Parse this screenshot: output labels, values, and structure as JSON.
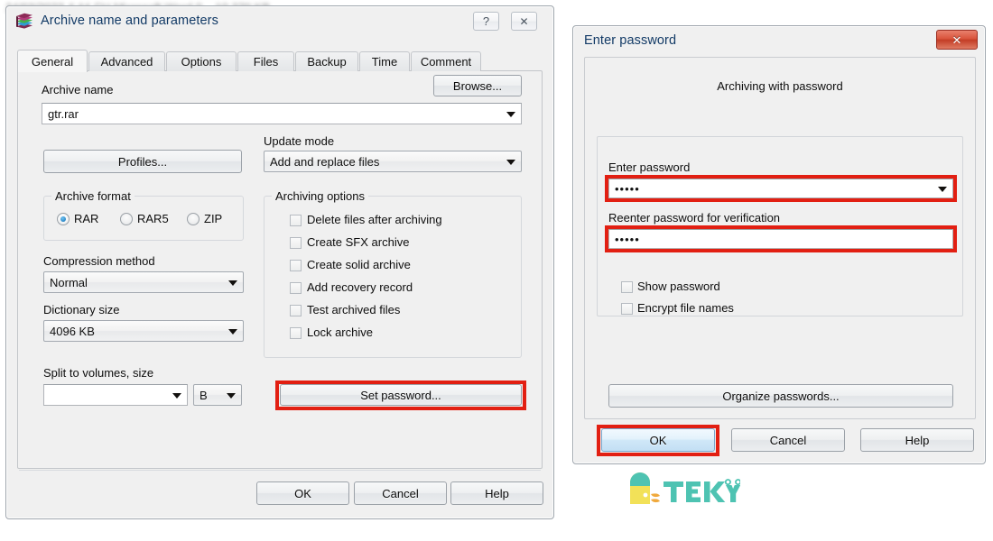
{
  "background_strip": {
    "blurred_text": "24/03/2023 4:44 CH      Microsoft Word 0...                  10.270 KB"
  },
  "archive_dialog": {
    "title": "Archive name and parameters",
    "icon": "winrar-books-icon",
    "titlebar_buttons": {
      "help": "?",
      "close": "✕"
    },
    "tabs": [
      {
        "label": "General",
        "active": true
      },
      {
        "label": "Advanced",
        "active": false
      },
      {
        "label": "Options",
        "active": false
      },
      {
        "label": "Files",
        "active": false
      },
      {
        "label": "Backup",
        "active": false
      },
      {
        "label": "Time",
        "active": false
      },
      {
        "label": "Comment",
        "active": false
      }
    ],
    "archive_name": {
      "label": "Archive name",
      "value": "gtr.rar"
    },
    "browse_button": "Browse...",
    "profiles_button": "Profiles...",
    "update_mode": {
      "label": "Update mode",
      "value": "Add and replace files"
    },
    "archive_format": {
      "label": "Archive format",
      "options": [
        {
          "label": "RAR",
          "selected": true
        },
        {
          "label": "RAR5",
          "selected": false
        },
        {
          "label": "ZIP",
          "selected": false
        }
      ]
    },
    "compression_method": {
      "label": "Compression method",
      "value": "Normal"
    },
    "dictionary_size": {
      "label": "Dictionary size",
      "value": "4096 KB"
    },
    "split_to_volumes": {
      "label": "Split to volumes, size",
      "value": "",
      "unit": "B"
    },
    "archiving_options": {
      "label": "Archiving options",
      "items": [
        {
          "label": "Delete files after archiving",
          "checked": false
        },
        {
          "label": "Create SFX archive",
          "checked": false
        },
        {
          "label": "Create solid archive",
          "checked": false
        },
        {
          "label": "Add recovery record",
          "checked": false
        },
        {
          "label": "Test archived files",
          "checked": false
        },
        {
          "label": "Lock archive",
          "checked": false
        }
      ]
    },
    "set_password_button": "Set password...",
    "footer_buttons": {
      "ok": "OK",
      "cancel": "Cancel",
      "help": "Help"
    }
  },
  "password_dialog": {
    "title": "Enter password",
    "close_button": "✕",
    "group_heading": "Archiving with password",
    "enter_password": {
      "label": "Enter password",
      "value": "•••••"
    },
    "reenter_password": {
      "label": "Reenter password for verification",
      "value": "•••••"
    },
    "checkboxes": [
      {
        "label": "Show password",
        "checked": false
      },
      {
        "label": "Encrypt file names",
        "checked": false
      }
    ],
    "organize_button": "Organize passwords...",
    "footer_buttons": {
      "ok": "OK",
      "cancel": "Cancel",
      "help": "Help"
    }
  },
  "watermark": {
    "text": "TEKY",
    "colors": {
      "letters": "#4ec3b2",
      "door_body": "#f5e04a",
      "door_top": "#4ec3b2",
      "leaf": "#f0a93c"
    }
  },
  "highlight_color": "#e21f12"
}
